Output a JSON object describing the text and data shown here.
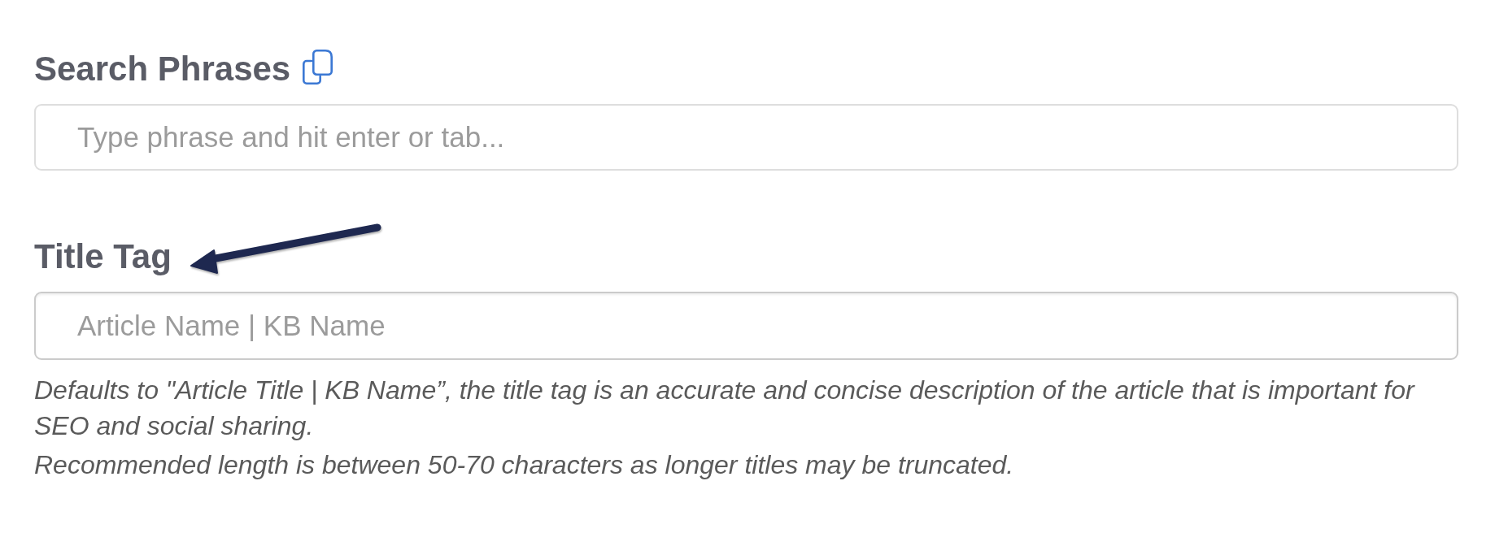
{
  "fields": [
    {
      "label": "Search Phrases",
      "copy_icon": true,
      "kind": "tags",
      "placeholder": "Type phrase and hit enter or tab..."
    },
    {
      "label": "Title Tag",
      "copy_icon": false,
      "kind": "text",
      "placeholder": "Article Name | KB Name",
      "help": [
        "Defaults to \"Article Title | KB Name”, the title tag is an accurate and concise description of the article that is important for SEO and social sharing.",
        "Recommended length is between 50-70 characters as longer titles may be truncated."
      ]
    }
  ]
}
